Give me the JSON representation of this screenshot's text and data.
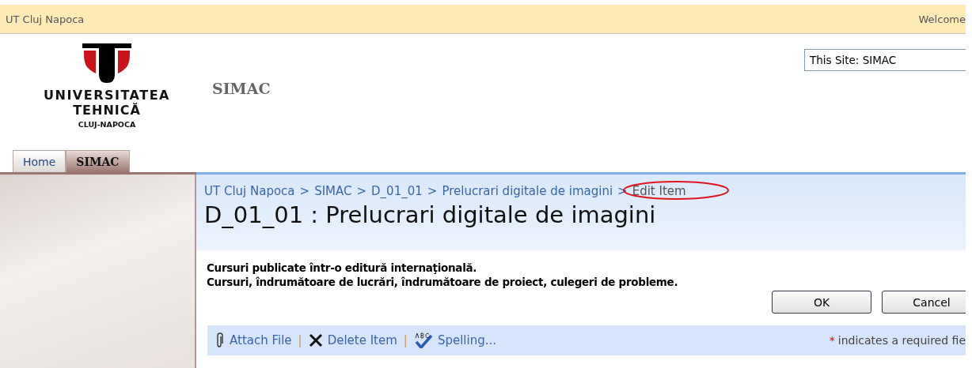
{
  "top_bar": {
    "site_name": "UT Cluj Napoca",
    "welcome": "Welcome"
  },
  "logo": {
    "lines": [
      "UNIVERSITATEA",
      "TEHNICĂ",
      "CLUJ-NAPOCA"
    ]
  },
  "site_title": "SIMAC",
  "search": {
    "scope": "This Site: SIMAC"
  },
  "tabs": [
    {
      "label": "Home",
      "selected": false
    },
    {
      "label": "SIMAC",
      "selected": true
    }
  ],
  "breadcrumb_separator": ">",
  "breadcrumb": [
    {
      "label": "UT Cluj Napoca",
      "kind": "link"
    },
    {
      "label": "SIMAC",
      "kind": "link"
    },
    {
      "label": "D_01_01",
      "kind": "link"
    },
    {
      "label": "Prelucrari digitale de imagini",
      "kind": "link"
    },
    {
      "label": "Edit Item",
      "kind": "current",
      "circled": true
    }
  ],
  "page_title": "D_01_01 : Prelucrari digitale de imagini",
  "description": [
    "Cursuri publicate într-o editură internaţională.",
    "Cursuri, îndrumătoare de lucrări, îndrumătoare de proiect, culegeri de probleme."
  ],
  "buttons": [
    "OK",
    "Cancel"
  ],
  "toolbar": {
    "separator": "|",
    "items": [
      {
        "label": "Attach File",
        "kind": "attach"
      },
      {
        "label": "Delete Item",
        "kind": "delete"
      },
      {
        "label": "Spelling...",
        "kind": "spelling"
      }
    ],
    "required_mark": "*",
    "required_note": "indicates a required fie"
  }
}
